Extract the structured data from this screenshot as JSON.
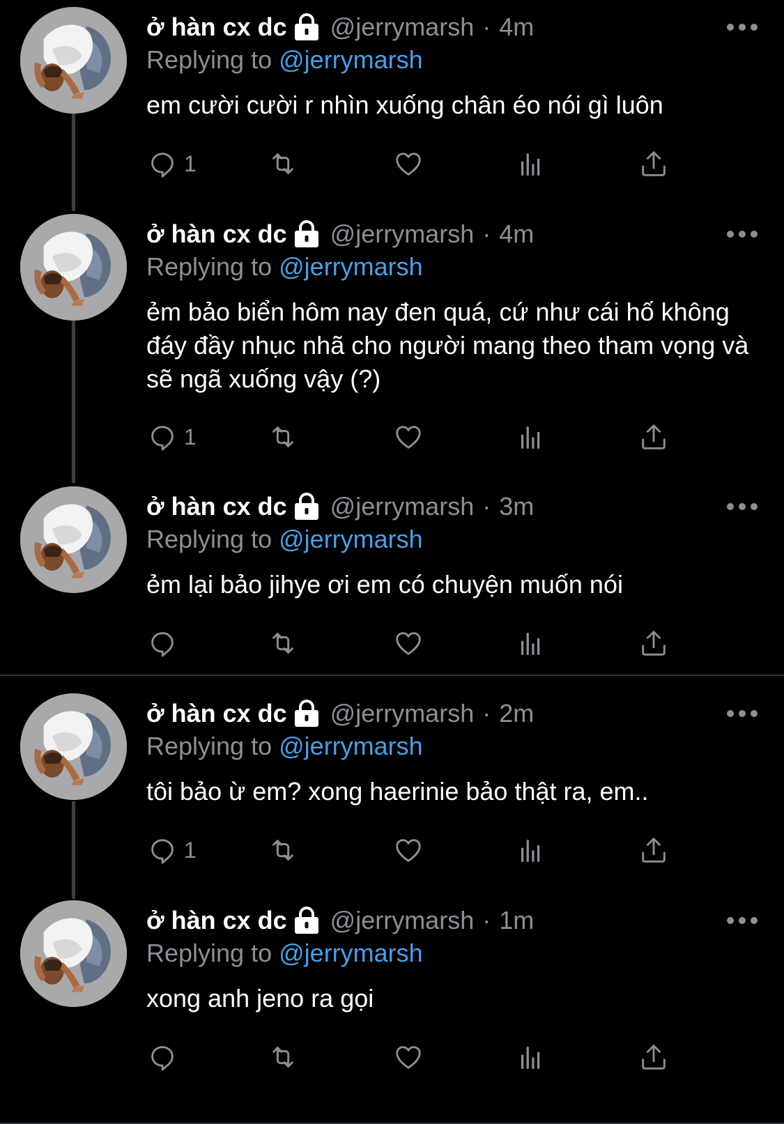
{
  "colors": {
    "background": "#000000",
    "text": "#ffffff",
    "muted": "#8b9096",
    "mention": "#4a9fe8",
    "divider": "#2f3336"
  },
  "icons": {
    "reply": "speech-bubble-icon",
    "retweet": "retweet-icon",
    "like": "heart-icon",
    "views": "bar-chart-icon",
    "share": "share-icon",
    "lock": "lock-icon",
    "more": "more-dots-icon"
  },
  "tweets": [
    {
      "name": "ở hàn cx dc",
      "handle": "@jerrymarsh",
      "sep": "·",
      "time": "4m",
      "replying_label": "Replying to",
      "replying_to": "@jerrymarsh",
      "text": "em cười cười r nhìn xuống chân éo nói gì luôn",
      "reply_count": "1"
    },
    {
      "name": "ở hàn cx dc",
      "handle": "@jerrymarsh",
      "sep": "·",
      "time": "4m",
      "replying_label": "Replying to",
      "replying_to": "@jerrymarsh",
      "text": "ẻm bảo biển hôm nay đen quá, cứ như cái hố không đáy đầy nhục nhã cho người mang theo tham vọng và sẽ ngã xuống vậy (?)",
      "reply_count": "1"
    },
    {
      "name": "ở hàn cx dc",
      "handle": "@jerrymarsh",
      "sep": "·",
      "time": "3m",
      "replying_label": "Replying to",
      "replying_to": "@jerrymarsh",
      "text": "ẻm lại bảo jihye ơi em có chuyện muốn nói",
      "reply_count": ""
    },
    {
      "name": "ở hàn cx dc",
      "handle": "@jerrymarsh",
      "sep": "·",
      "time": "2m",
      "replying_label": "Replying to",
      "replying_to": "@jerrymarsh",
      "text": "tôi bảo ừ em? xong haerinie bảo thật ra, em..",
      "reply_count": "1"
    },
    {
      "name": "ở hàn cx dc",
      "handle": "@jerrymarsh",
      "sep": "·",
      "time": "1m",
      "replying_label": "Replying to",
      "replying_to": "@jerrymarsh",
      "text": "xong anh jeno ra gọi",
      "reply_count": ""
    }
  ]
}
